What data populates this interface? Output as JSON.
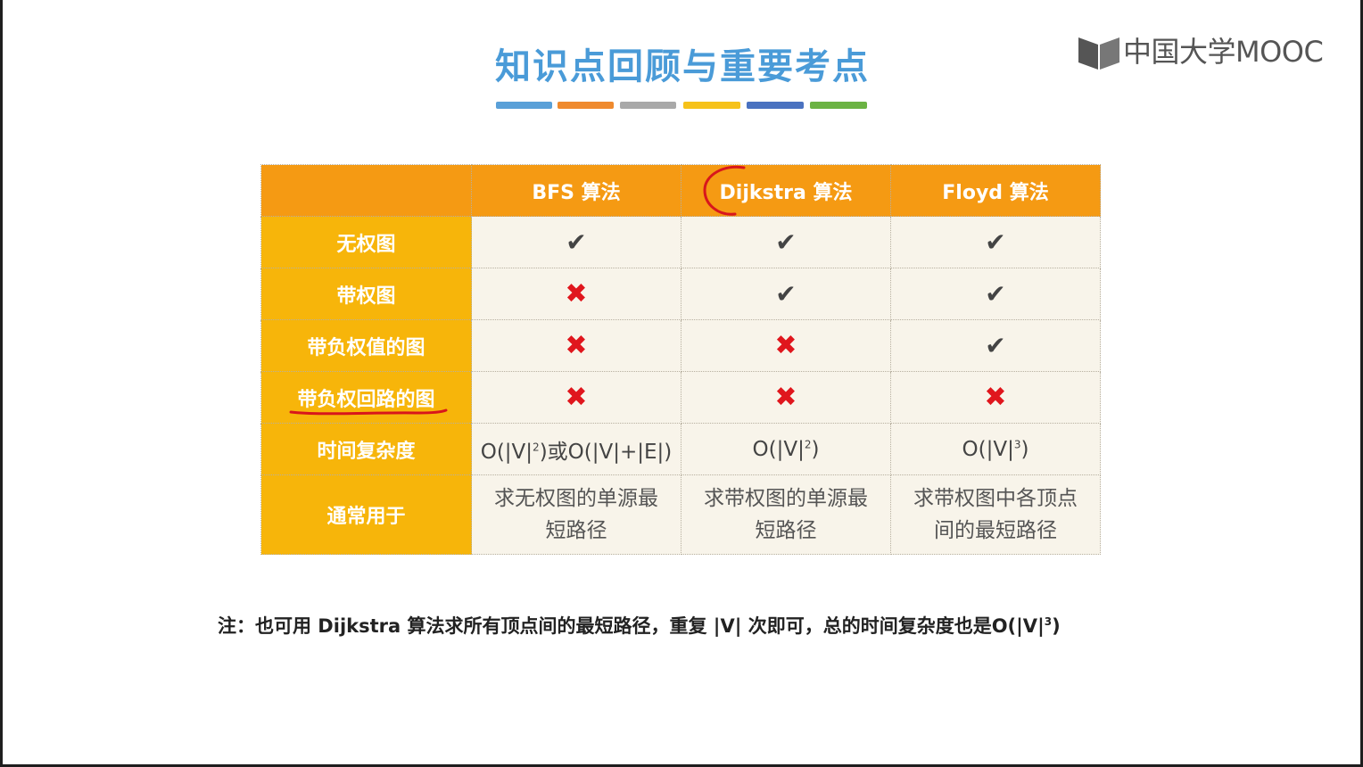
{
  "slide": {
    "title": "知识点回顾与重要考点",
    "title_bar_colors": [
      "#5aa0d8",
      "#ef8a2e",
      "#a9a9a9",
      "#f6c21a",
      "#4a72c0",
      "#6bb343"
    ]
  },
  "logo": {
    "text": "中国大学MOOC",
    "icon": "open-book-icon"
  },
  "table": {
    "headers": [
      "",
      "BFS 算法",
      "Dijkstra 算法",
      "Floyd 算法"
    ],
    "rows": [
      {
        "label": "无权图",
        "values": [
          "✔",
          "✔",
          "✔"
        ],
        "kinds": [
          "check",
          "check",
          "check"
        ]
      },
      {
        "label": "带权图",
        "values": [
          "✖",
          "✔",
          "✔"
        ],
        "kinds": [
          "cross",
          "check",
          "check"
        ]
      },
      {
        "label": "带负权值的图",
        "values": [
          "✖",
          "✖",
          "✔"
        ],
        "kinds": [
          "cross",
          "cross",
          "check"
        ]
      },
      {
        "label": "带负权回路的图",
        "values": [
          "✖",
          "✖",
          "✖"
        ],
        "kinds": [
          "cross",
          "cross",
          "cross"
        ]
      }
    ],
    "complexity": {
      "label": "时间复杂度",
      "bfs_prefix": "O(|V|",
      "bfs_exp": "2",
      "bfs_suffix": ")或O(|V|+|E|)",
      "dijkstra_prefix": "O(|V|",
      "dijkstra_exp": "2",
      "dijkstra_suffix": ")",
      "floyd_prefix": "O(|V|",
      "floyd_exp": "3",
      "floyd_suffix": ")"
    },
    "usage": {
      "label": "通常用于",
      "bfs_line1": "求无权图的单源最",
      "bfs_line2": "短路径",
      "dijkstra_line1": "求带权图的单源最",
      "dijkstra_line2": "短路径",
      "floyd_line1": "求带权图中各顶点",
      "floyd_line2": "间的最短路径"
    }
  },
  "note": {
    "main": "注：也可用 Dijkstra 算法求所有顶点间的最短路径，重复 |V| 次即可，总的时间复杂度也是O(|V|",
    "exp": "3",
    "close": ")"
  },
  "colors": {
    "header_orange": "#f59a13",
    "row_header_yellow": "#f7b50a",
    "cell_bg": "#f8f4ea",
    "cross_red": "#e0161d",
    "annotation_red": "#d8161c"
  }
}
